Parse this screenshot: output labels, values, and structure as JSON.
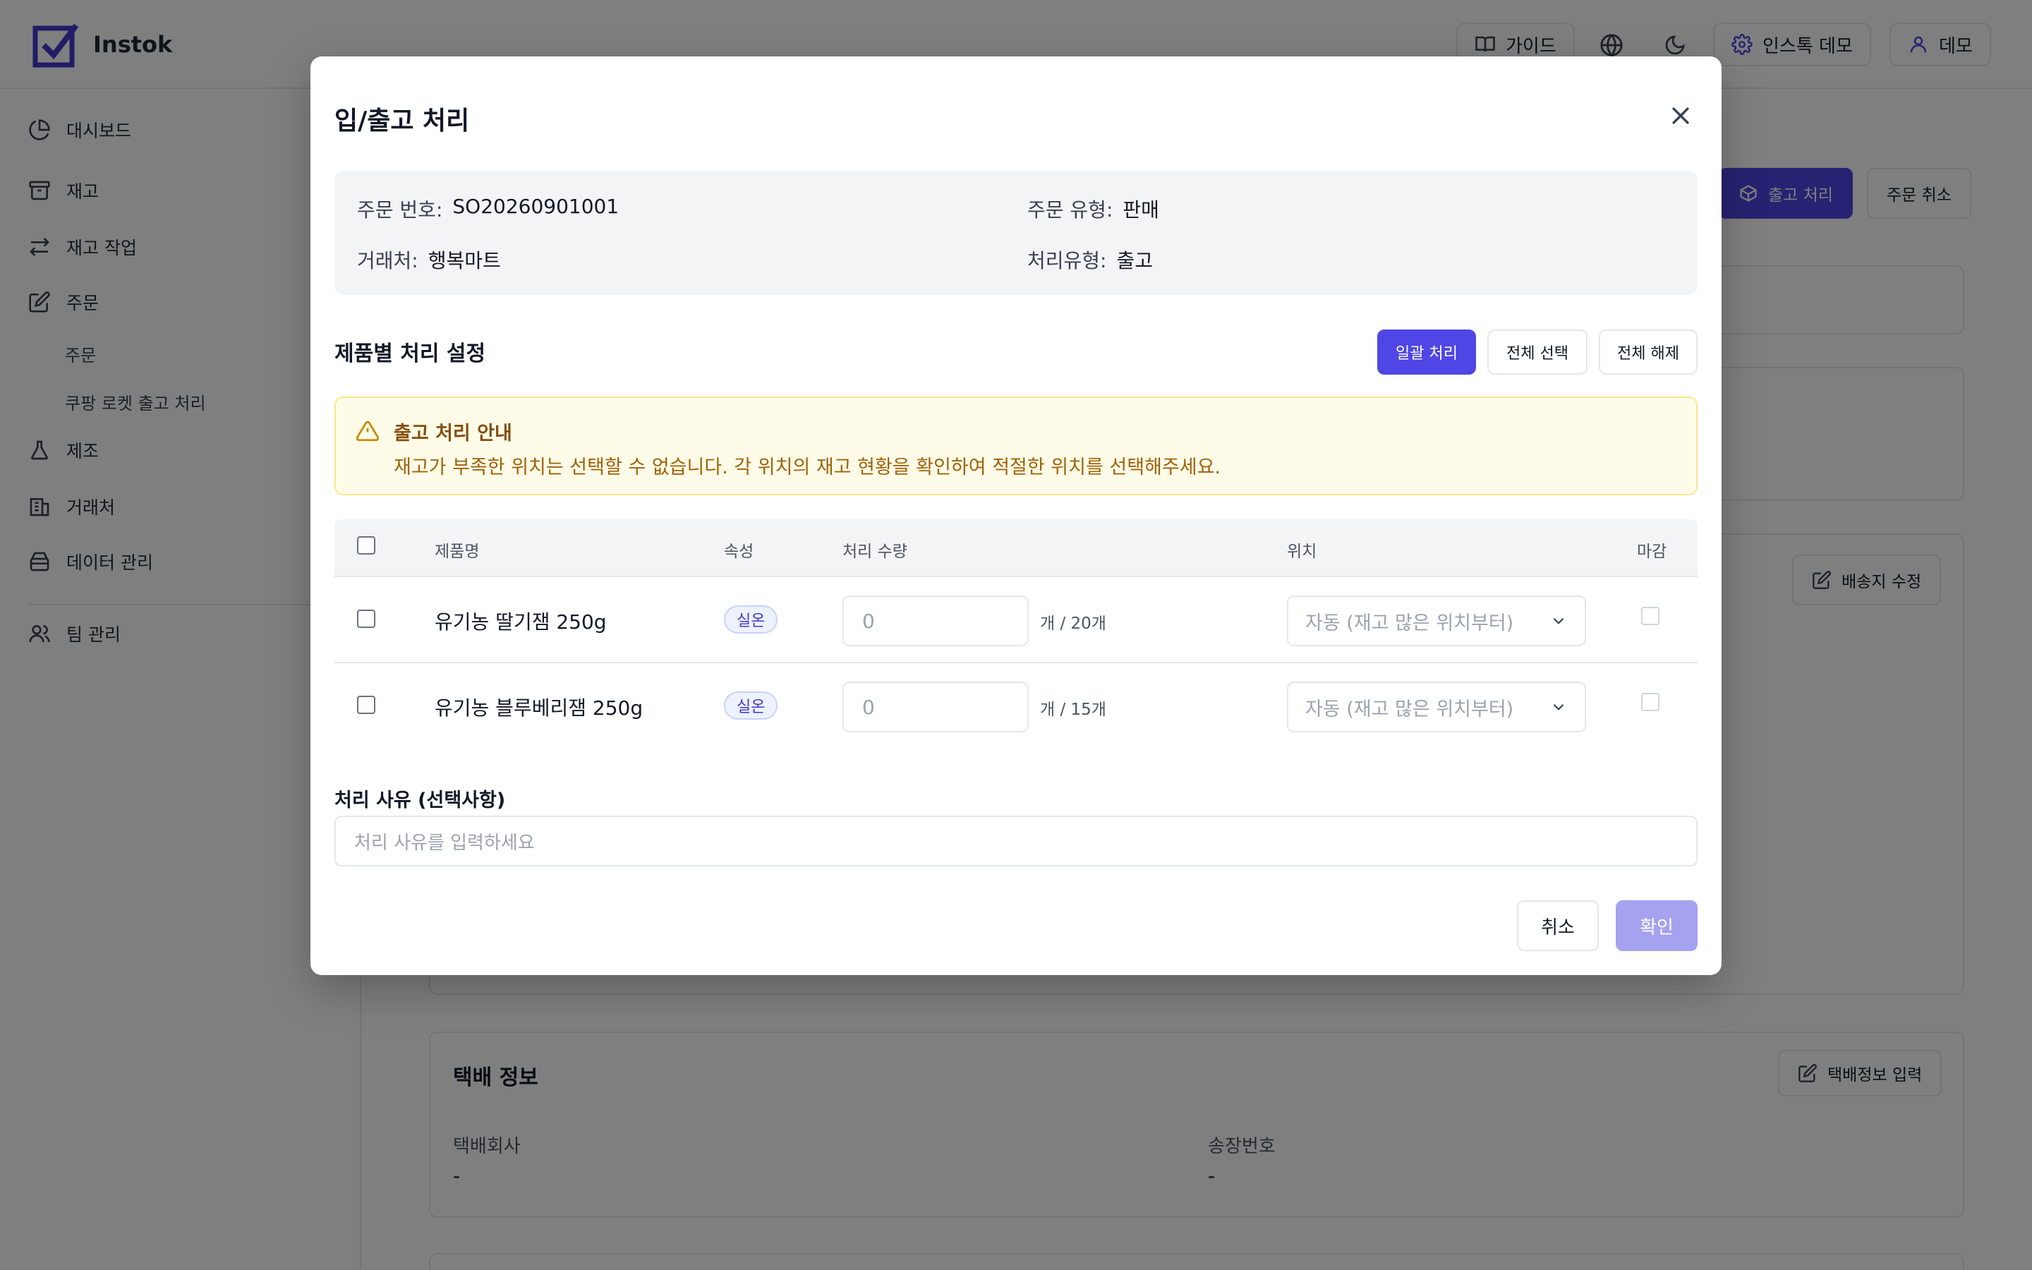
{
  "app": {
    "name": "Instok"
  },
  "topbar": {
    "guide_label": "가이드",
    "org_label": "인스톡 데모",
    "user_label": "데모"
  },
  "sidebar": {
    "items": [
      {
        "label": "대시보드"
      },
      {
        "label": "재고"
      },
      {
        "label": "재고 작업"
      },
      {
        "label": "주문"
      },
      {
        "label": "제조"
      },
      {
        "label": "거래처"
      },
      {
        "label": "데이터 관리"
      },
      {
        "label": "팀 관리"
      }
    ],
    "sub_items": [
      {
        "label": "주문"
      },
      {
        "label": "쿠팡 로켓 출고 처리"
      }
    ]
  },
  "background": {
    "ship_button": "출고 처리",
    "cancel_order_button": "주문 취소",
    "edit_address_button": "배송지 수정",
    "delivery_title": "택배 정보",
    "delivery_input_button": "택배정보 입력",
    "courier_label": "택배회사",
    "courier_value": "-",
    "tracking_label": "송장번호",
    "tracking_value": "-"
  },
  "modal": {
    "title": "입/출고 처리",
    "info": {
      "order_no_label": "주문 번호:",
      "order_no": "SO20260901001",
      "order_type_label": "주문 유형:",
      "order_type": "판매",
      "client_label": "거래처:",
      "client": "행복마트",
      "process_type_label": "처리유형:",
      "process_type": "출고"
    },
    "section_title": "제품별 처리 설정",
    "bulk_button": "일괄 처리",
    "select_all_button": "전체 선택",
    "deselect_all_button": "전체 해제",
    "warning": {
      "title": "출고 처리 안내",
      "text": "재고가 부족한 위치는 선택할 수 없습니다. 각 위치의 재고 현황을 확인하여 적절한 위치를 선택해주세요."
    },
    "table": {
      "headers": [
        "제품명",
        "속성",
        "처리 수량",
        "위치",
        "마감"
      ],
      "rows": [
        {
          "name": "유기농 딸기잼 250g",
          "attr": "실온",
          "qty": "0",
          "max": "개 / 20개",
          "location": "자동 (재고 많은 위치부터)"
        },
        {
          "name": "유기농 블루베리잼 250g",
          "attr": "실온",
          "qty": "0",
          "max": "개 / 15개",
          "location": "자동 (재고 많은 위치부터)"
        }
      ]
    },
    "reason_label": "처리 사유 (선택사항)",
    "reason_placeholder": "처리 사유를 입력하세요",
    "cancel_button": "취소",
    "confirm_button": "확인"
  },
  "colors": {
    "primary": "#4f46e5",
    "overlay": "rgba(0,0,0,0.5)",
    "warning_bg": "#fefce8",
    "warning_text": "#854d0e"
  }
}
